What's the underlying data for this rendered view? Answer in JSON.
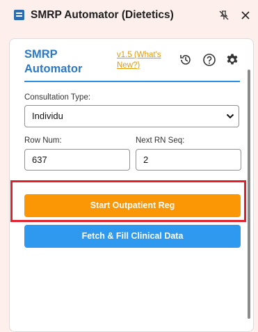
{
  "window": {
    "title": "SMRP Automator (Dietetics)",
    "icons": [
      "app-icon",
      "unpin-icon",
      "close-icon"
    ]
  },
  "header": {
    "brand": "SMRP Automator",
    "version_link": "v1.5 (What's New?)",
    "icons": [
      "history-icon",
      "help-icon",
      "gear-icon"
    ]
  },
  "form": {
    "consultation_label": "Consultation Type:",
    "consultation_value": "Individu",
    "row_num_label": "Row Num:",
    "row_num_value": "637",
    "next_rn_label": "Next RN Seq:",
    "next_rn_value": "2"
  },
  "actions": {
    "start_label": "Start Outpatient Reg",
    "fetch_label": "Fetch & Fill Clinical Data"
  },
  "colors": {
    "brand": "#2b78c5",
    "link": "#e39a06",
    "start_button": "#fb9604",
    "fetch_button": "#2f99f0",
    "highlight": "#e0202c"
  }
}
